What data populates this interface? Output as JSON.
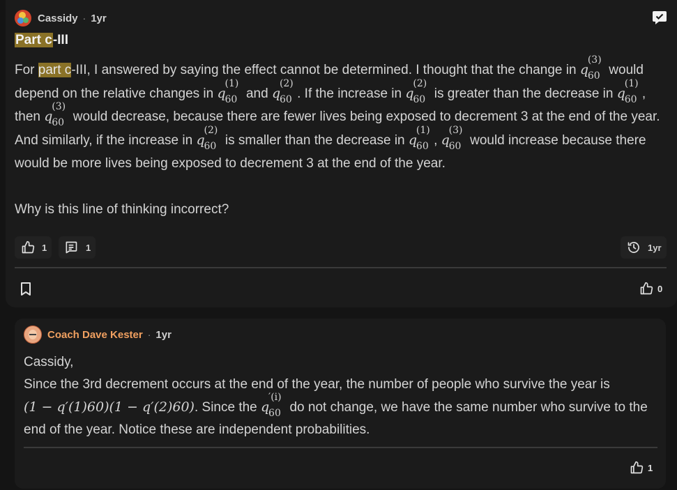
{
  "post": {
    "author": "Cassidy",
    "separator": "·",
    "time": "1yr",
    "title_highlight": "Part c",
    "title_rest": "-III",
    "body_intro": "For ",
    "body_highlight": "part c",
    "body_seg1": "-III, I answered by saying the effect cannot be determined. I thought that the change in ",
    "body_seg2": " would depend on the relative changes in ",
    "body_seg3": " and ",
    "body_seg4": ". If the increase in ",
    "body_seg5": " is greater than the decrease in ",
    "body_seg6": ", then ",
    "body_seg7": " would decrease, because there are fewer lives being exposed to decrement 3 at the end of the year. And similarly, if the increase in ",
    "body_seg8": " is smaller than the decrease in ",
    "body_seg9": ", ",
    "body_seg10": " would increase because there would be more lives being exposed to decrement 3 at the end of the year.",
    "q_base": "q",
    "q_sub": "60",
    "sup_1": "(1)",
    "sup_2": "(2)",
    "sup_3": "(3)",
    "question": "Why is this line of thinking incorrect?",
    "likes": "1",
    "comments": "1",
    "history_time": "1yr",
    "reaction_count": "0"
  },
  "reply": {
    "author": "Coach Dave Kester",
    "separator": "·",
    "time": "1yr",
    "greeting": "Cassidy,",
    "line1": "Since the 3rd decrement occurs at the end of the year, the number of people who survive the year is",
    "formula": "(1 − q′(1)60)(1 − q′(2)60)",
    "mid": ". Since the ",
    "qi_sup": "′(i)",
    "end": " do not change, we have the same number who survive to the end of the year. Notice these are independent probabilities.",
    "likes": "1"
  },
  "icons": [
    "message-check-icon",
    "thumbs-up-icon",
    "comment-icon",
    "history-icon",
    "bookmark-icon"
  ],
  "colors": {
    "highlight": "#8a7227",
    "coach_name": "#f0a060",
    "background": "#141414"
  }
}
